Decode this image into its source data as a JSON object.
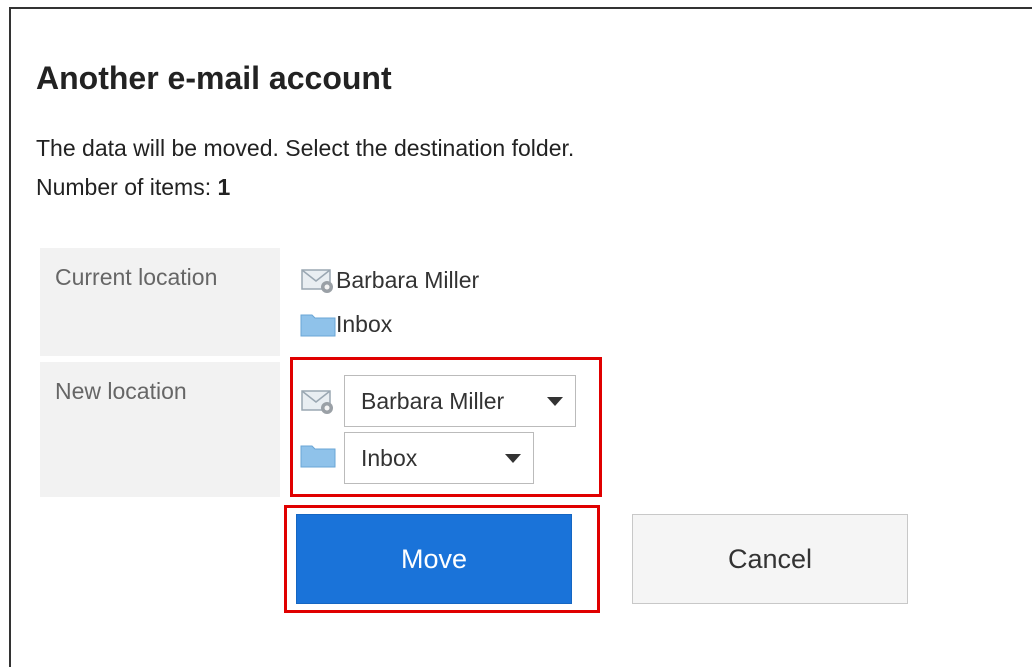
{
  "dialog": {
    "title": "Another e-mail account",
    "message": "The data will be moved. Select the destination folder.",
    "count_label": "Number of items:",
    "count_value": "1"
  },
  "current_location": {
    "label": "Current location",
    "account": "Barbara Miller",
    "folder": "Inbox"
  },
  "new_location": {
    "label": "New location",
    "account_select": "Barbara Miller",
    "folder_select": "Inbox"
  },
  "buttons": {
    "move": "Move",
    "cancel": "Cancel"
  },
  "colors": {
    "primary": "#1a73d9",
    "highlight": "#e00000",
    "label_bg": "#f2f2f2"
  },
  "icons": {
    "account": "mail-account-icon",
    "folder": "folder-icon"
  }
}
